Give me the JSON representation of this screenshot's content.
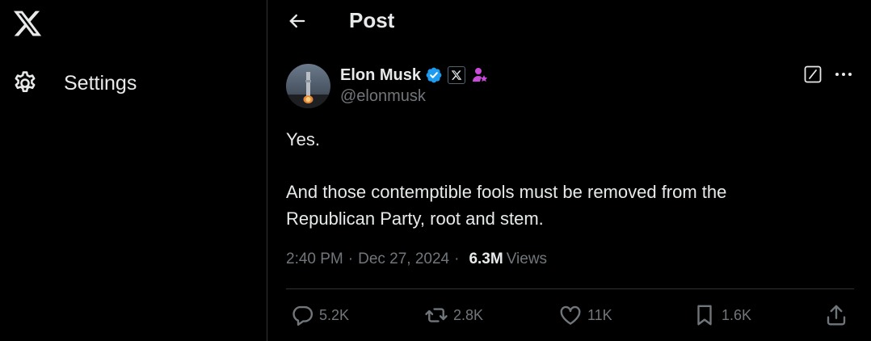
{
  "sidebar": {
    "logo_icon": "x-logo-icon",
    "settings_label": "Settings",
    "settings_icon": "gear-icon"
  },
  "header": {
    "title": "Post",
    "back_icon": "arrow-left-icon"
  },
  "post": {
    "author": {
      "display_name": "Elon Musk",
      "handle": "@elonmusk",
      "verified_color": "#1d9bf0",
      "affiliation_badge": "x-affiliate-badge-icon",
      "gov_badge_color": "#c94ad8"
    },
    "text_lines": [
      "Yes.",
      "And those contemptible fools must be removed from the",
      "Republican Party, root and stem."
    ],
    "time": "2:40 PM",
    "date": "Dec 27, 2024",
    "separator": "·",
    "views_count": "6.3M",
    "views_label": "Views",
    "actions": {
      "replies": "5.2K",
      "reposts": "2.8K",
      "likes": "11K",
      "bookmarks": "1.6K"
    }
  },
  "colors": {
    "background": "#000000",
    "text": "#e7e9ea",
    "muted": "#71767b",
    "border": "#2f3336",
    "accent": "#1d9bf0"
  }
}
